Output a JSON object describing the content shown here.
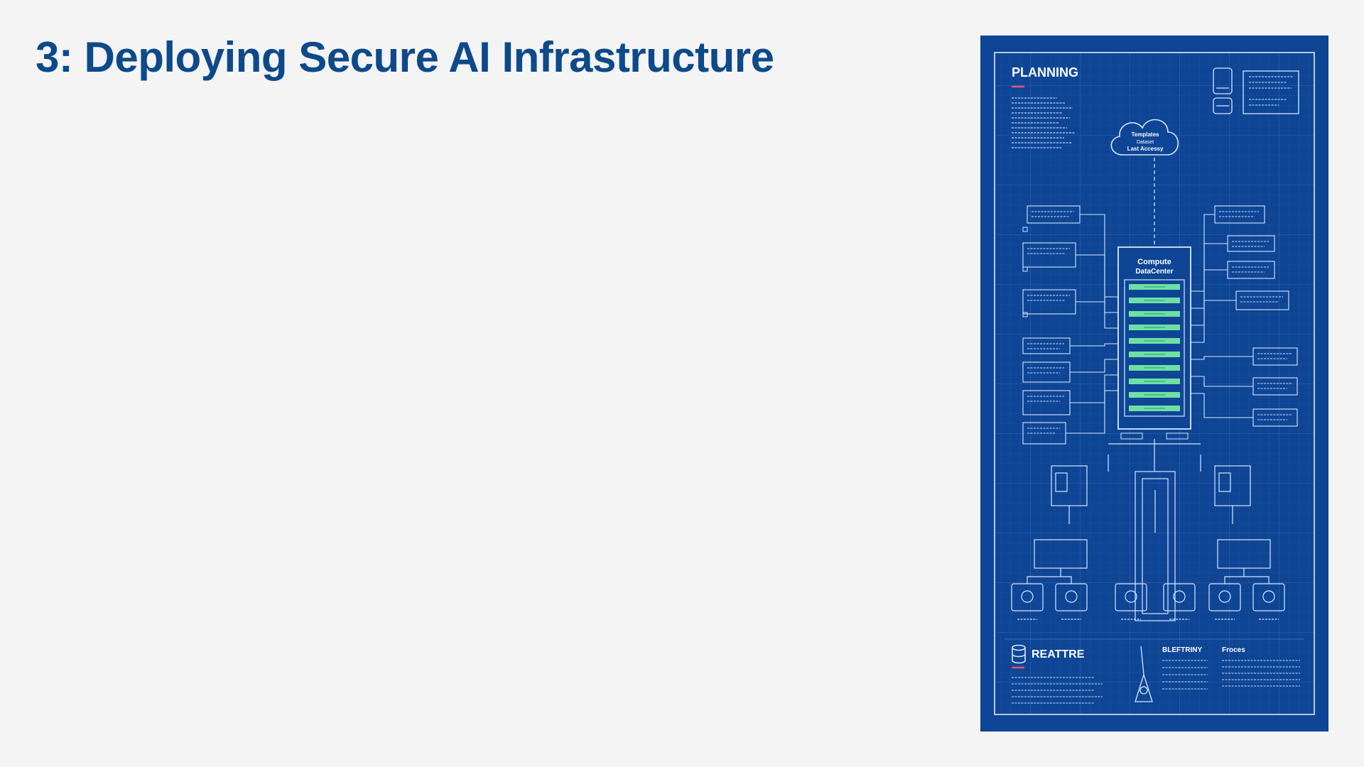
{
  "slide": {
    "title": "3: Deploying Secure AI Infrastructure"
  },
  "blueprint": {
    "planning_heading": "PLANNING",
    "cloud_label_lines": [
      "Templates",
      "Dataset",
      "Last Accessy"
    ],
    "datacenter_label_lines": [
      "Compute",
      "DataCenter"
    ],
    "bottom_left_heading": "REATTRE",
    "bottom_mid_heading": "BLEFTRINY",
    "bottom_right_heading": "Froces",
    "colors": {
      "background": "#0e4595",
      "line": "#dbe8ff",
      "rack_slot": "#6ee0a6",
      "accent_underline": "#e0556b"
    },
    "icons": [
      "cloud-icon",
      "server-rack-icon",
      "database-icon",
      "device-icon"
    ]
  }
}
